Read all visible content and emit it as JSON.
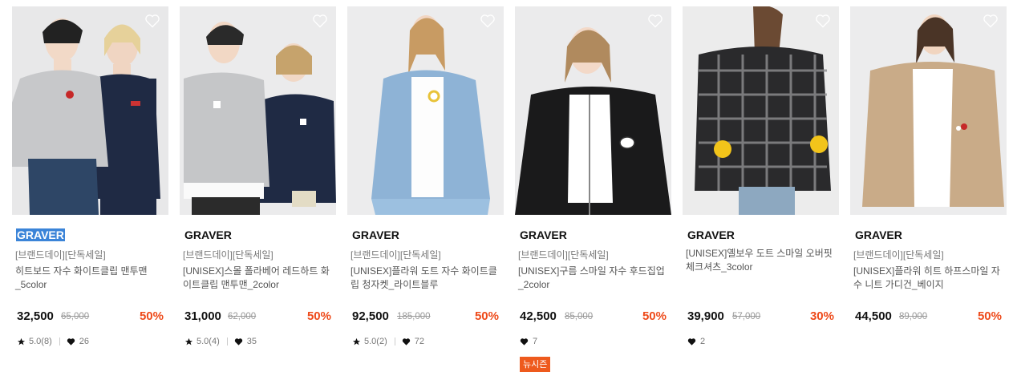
{
  "products": [
    {
      "brand": "GRAVER",
      "tag": "[브랜드데이][단독세일]",
      "name": "히트보드 자수 화이트클립 맨투맨_5color",
      "price": "32,500",
      "original": "65,000",
      "discount": "50%",
      "rating": "5.0(8)",
      "likes": "26",
      "badge": "",
      "brand_selected": true,
      "scene": "duo-sweat"
    },
    {
      "brand": "GRAVER",
      "tag": "[브랜드데이][단독세일]",
      "name": "[UNISEX]스몰 폴라베어 레드하트 화이트클립 맨투맨_2color",
      "price": "31,000",
      "original": "62,000",
      "discount": "50%",
      "rating": "5.0(4)",
      "likes": "35",
      "badge": "",
      "brand_selected": false,
      "scene": "duo-bear"
    },
    {
      "brand": "GRAVER",
      "tag": "[브랜드데이][단독세일]",
      "name": "[UNISEX]플라워 도트 자수 화이트클립 청자켓_라이트블루",
      "price": "92,500",
      "original": "185,000",
      "discount": "50%",
      "rating": "5.0(2)",
      "likes": "72",
      "badge": "",
      "brand_selected": false,
      "scene": "denim"
    },
    {
      "brand": "GRAVER",
      "tag": "[브랜드데이][단독세일]",
      "name": "[UNISEX]구름 스마일 자수 후드집업_2color",
      "price": "42,500",
      "original": "85,000",
      "discount": "50%",
      "rating": "",
      "likes": "7",
      "badge": "뉴시즌",
      "brand_selected": false,
      "scene": "hoodie"
    },
    {
      "brand": "GRAVER",
      "tag": "[UNISEX]옐보우 도트 스마일 오버핏 체크셔츠_3color",
      "name": "",
      "price": "39,900",
      "original": "57,000",
      "discount": "30%",
      "rating": "",
      "likes": "2",
      "badge": "",
      "brand_selected": false,
      "scene": "check"
    },
    {
      "brand": "GRAVER",
      "tag": "[브랜드데이][단독세일]",
      "name": "[UNISEX]플라워 히트 하프스마일 자수 니트 가디건_베이지",
      "price": "44,500",
      "original": "89,000",
      "discount": "50%",
      "rating": "",
      "likes": "",
      "badge": "",
      "brand_selected": false,
      "scene": "cardigan"
    }
  ],
  "colors": {
    "accent": "#ee4a1a",
    "badge": "#ee5a1d",
    "selection": "#3b84d8"
  }
}
